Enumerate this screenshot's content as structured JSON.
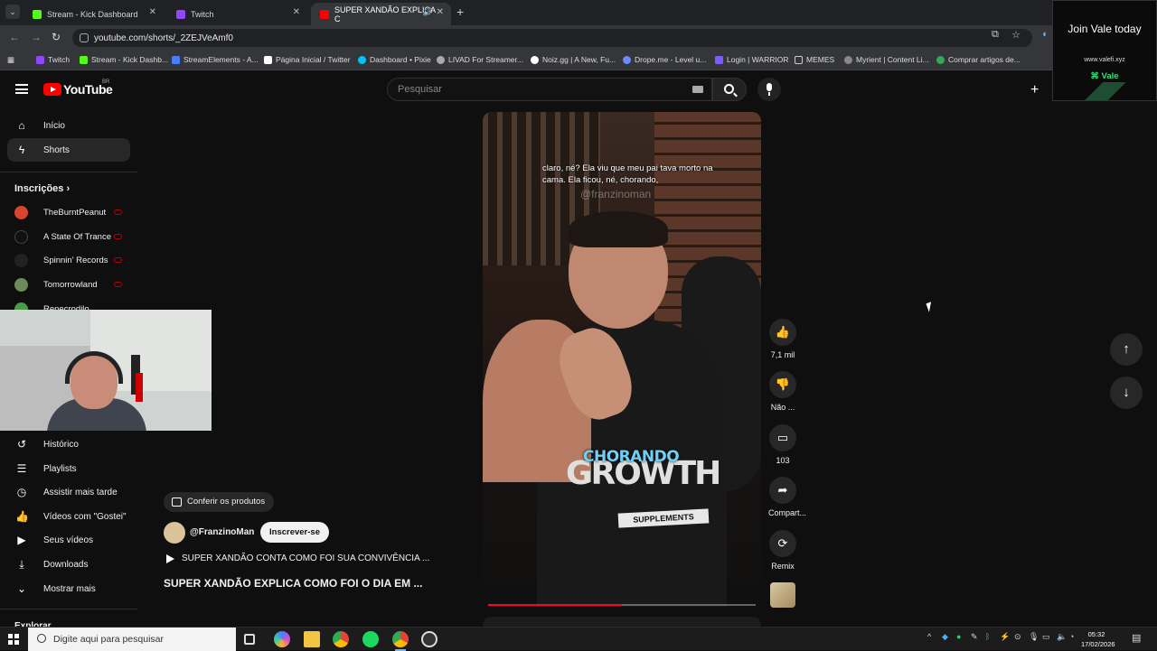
{
  "browser": {
    "tabs": [
      {
        "title": "Stream - Kick Dashboard",
        "color": "#53fc18"
      },
      {
        "title": "Twitch",
        "color": "#9146ff"
      },
      {
        "title": "SUPER XANDÃO EXPLICA C",
        "color": "#ff0000"
      }
    ],
    "url": "youtube.com/shorts/_2ZEJVeAmf0",
    "bookmarks": [
      {
        "label": "Twitch",
        "color": "#9146ff"
      },
      {
        "label": "Stream - Kick Dashb...",
        "color": "#53fc18"
      },
      {
        "label": "StreamElements - A...",
        "color": "#4a7cff"
      },
      {
        "label": "Página Inicial / Twitter",
        "color": "#ffffff"
      },
      {
        "label": "Dashboard • Pixie",
        "color": "#00c2ff"
      },
      {
        "label": "LIVAD For Streamer...",
        "color": "#aaaaaa"
      },
      {
        "label": "Noiz.gg | A New, Fu...",
        "color": "#ffffff"
      },
      {
        "label": "Drope.me - Level u...",
        "color": "#6b8cff"
      },
      {
        "label": "Login | WARRIOR",
        "color": "#7d5cff"
      },
      {
        "label": "MEMES",
        "color": "#cccccc"
      },
      {
        "label": "Myrient | Content Li...",
        "color": "#888888"
      },
      {
        "label": "Comprar artigos de...",
        "color": "#34a853"
      }
    ]
  },
  "youtube": {
    "logo_text": "YouTube",
    "region": "BR",
    "search_placeholder": "Pesquisar",
    "nav": [
      {
        "label": "Início",
        "icon": "home-icon"
      },
      {
        "label": "Shorts",
        "icon": "shorts-icon"
      }
    ],
    "subscriptions_title": "Inscrições",
    "subscriptions": [
      {
        "name": "TheBurntPeanut",
        "color": "#d9442f"
      },
      {
        "name": "A State Of Trance",
        "color": "#111111"
      },
      {
        "name": "Spinnin' Records",
        "color": "#222222"
      },
      {
        "name": "Tomorrowland",
        "color": "#6b8c5a"
      },
      {
        "name": "Renecrodilo",
        "color": "#4a9a4a"
      }
    ],
    "you_items": [
      {
        "label": "Histórico",
        "icon": "history-icon"
      },
      {
        "label": "Playlists",
        "icon": "playlists-icon"
      },
      {
        "label": "Assistir mais tarde",
        "icon": "watch-later-icon"
      },
      {
        "label": "Vídeos com \"Gostei\"",
        "icon": "liked-icon"
      },
      {
        "label": "Seus vídeos",
        "icon": "your-videos-icon"
      },
      {
        "label": "Downloads",
        "icon": "downloads-icon"
      },
      {
        "label": "Mostrar mais",
        "icon": "chevron-down-icon"
      }
    ],
    "explore_title": "Explorar"
  },
  "short": {
    "caption": "claro, né? Ela viu que meu pai tava morto na cama. Ela ficou, né, chorando,",
    "watermark": "@franzinoman",
    "highlight_word": "CHORANDO",
    "shirt_text": "GROWTH",
    "shirt_sub": "SUPPLEMENTS",
    "progress": 0.5,
    "actions": {
      "like_count": "7,1 mil",
      "dislike_label": "Não ...",
      "comments_count": "103",
      "share_label": "Compart...",
      "remix_label": "Remix"
    },
    "products_label": "Conferir os produtos",
    "channel": "@FranzinoMan",
    "subscribe_label": "Inscrever-se",
    "playlist_title": "SUPER XANDÃO CONTA COMO FOI SUA CONVIVÊNCIA ...",
    "title": "SUPER XANDÃO EXPLICA COMO FOI O DIA EM ..."
  },
  "ad": {
    "headline": "Join Vale today",
    "url": "www.valefi.xyz",
    "brand": "Vale"
  },
  "taskbar": {
    "search_placeholder": "Digite aqui para pesquisar",
    "time": "05:32",
    "date": "17/02/2026"
  }
}
